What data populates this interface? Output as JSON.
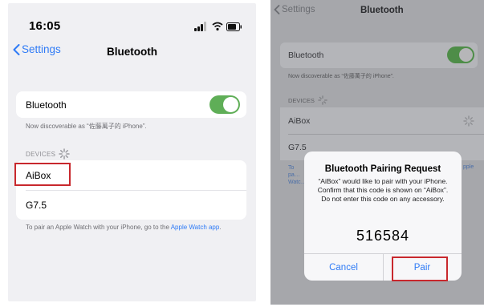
{
  "left": {
    "status_time": "16:05",
    "back_label": "Settings",
    "nav_title": "Bluetooth",
    "bluetooth_row_label": "Bluetooth",
    "bluetooth_on": true,
    "discoverable_text": "Now discoverable as “佐藤萬子的 iPhone”.",
    "devices_header": "DEVICES",
    "devices": [
      "AiBox",
      "G7.5"
    ],
    "highlighted_device": "AiBox",
    "apple_watch_prefix": "To pair an Apple Watch with your iPhone, go to the ",
    "apple_watch_link": "Apple Watch app",
    "apple_watch_suffix": "."
  },
  "right": {
    "back_label": "Settings",
    "nav_title": "Bluetooth",
    "bluetooth_row_label": "Bluetooth",
    "discoverable_text": "Now discoverable as “佐藤萬子的 iPhone”.",
    "devices_header": "DEVICES",
    "devices": [
      "AiBox",
      "G7.5"
    ],
    "footer_fragment_left": "To pa… Watc…",
    "footer_fragment_right": "pple",
    "dialog": {
      "title": "Bluetooth Pairing Request",
      "message": "“AiBox” would like to pair with your iPhone. Confirm that this code is shown on “AiBox”. Do not enter this code on any accessory.",
      "code": "516584",
      "cancel_label": "Cancel",
      "pair_label": "Pair"
    }
  },
  "colors": {
    "ios_blue": "#2f7bf6",
    "toggle_green": "#5fae57",
    "highlight_red": "#c8282d"
  }
}
